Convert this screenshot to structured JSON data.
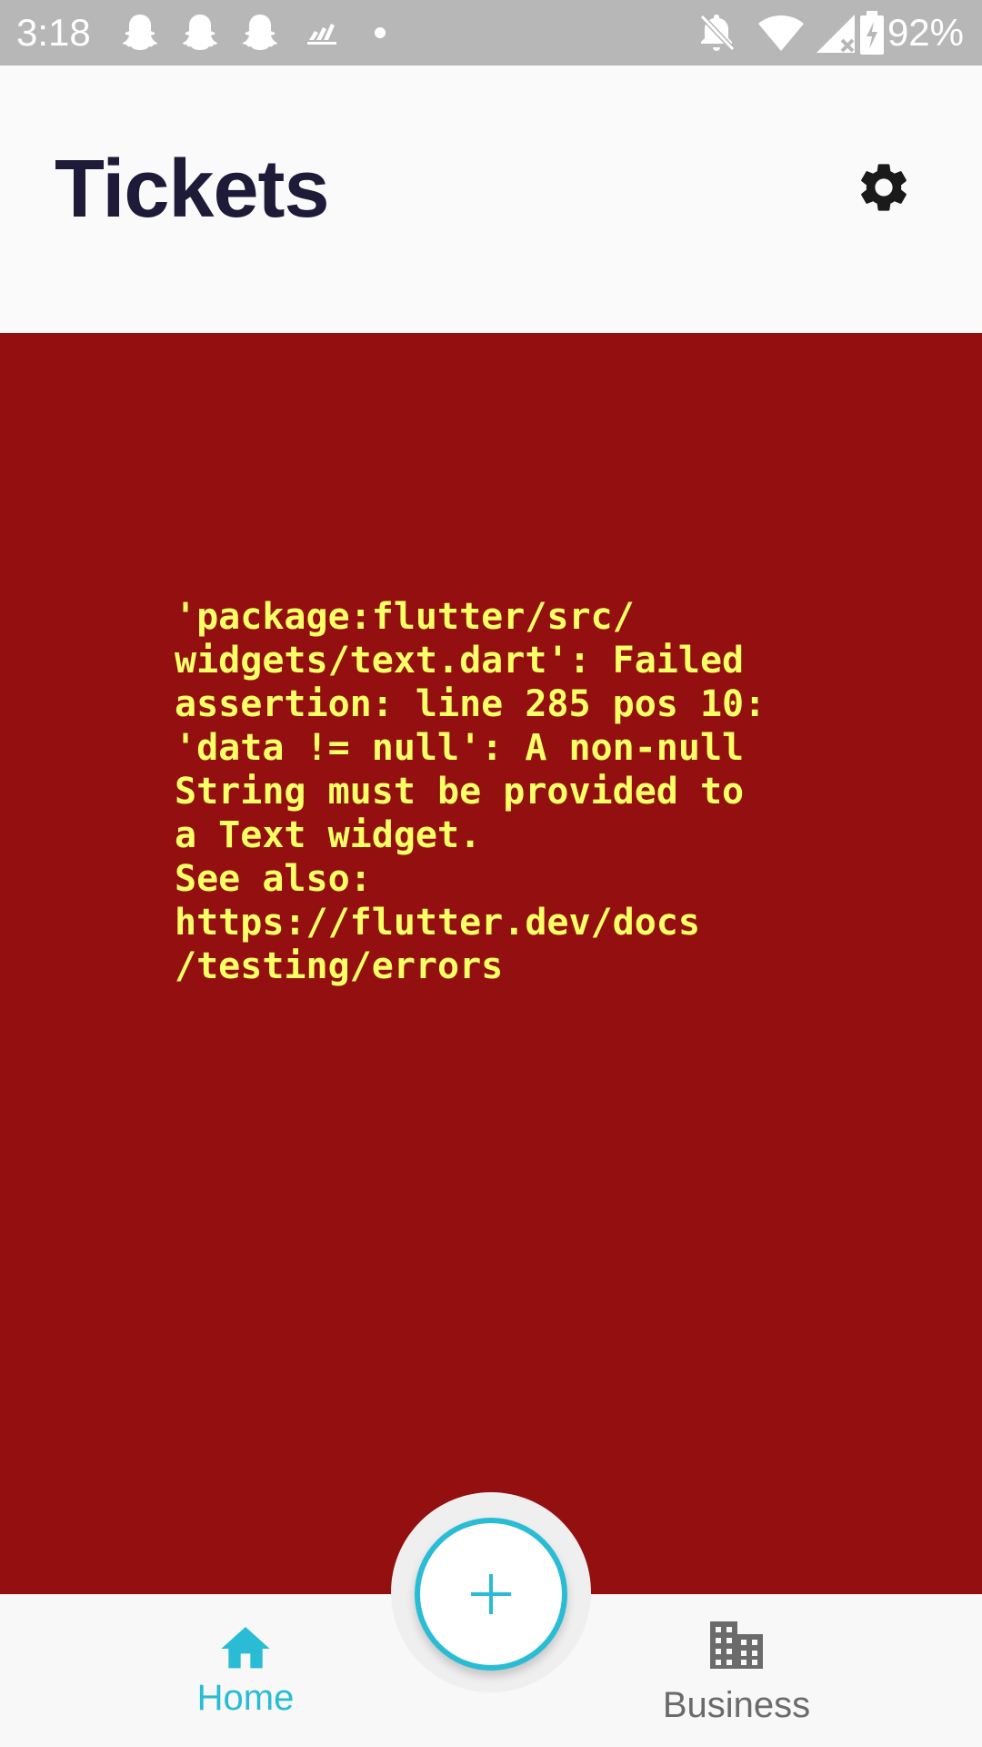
{
  "status_bar": {
    "time": "3:18",
    "battery": "92%",
    "left_icons": [
      "snapchat-icon",
      "snapchat-icon",
      "snapchat-icon",
      "adidas-icon",
      "dot-icon"
    ],
    "right_icons": [
      "notifications-off-icon",
      "wifi-icon",
      "signal-icon",
      "battery-charging-icon"
    ]
  },
  "header": {
    "title": "Tickets",
    "settings_icon": "gear-icon"
  },
  "error": {
    "message": "'package:flutter/src/\nwidgets/text.dart': Failed\nassertion: line 285 pos 10:\n'data != null': A non-null\nString must be provided to\na Text widget.\nSee also:\nhttps://flutter.dev/docs\n/testing/errors",
    "background_color": "#930f10",
    "text_color": "#ffff66"
  },
  "fab": {
    "icon": "plus-icon"
  },
  "bottom_nav": {
    "items": [
      {
        "label": "Home",
        "icon": "home-icon",
        "active": true
      },
      {
        "label": "Business",
        "icon": "business-icon",
        "active": false
      }
    ],
    "active_color": "#29bcd4",
    "inactive_color": "#6b6b6b"
  }
}
